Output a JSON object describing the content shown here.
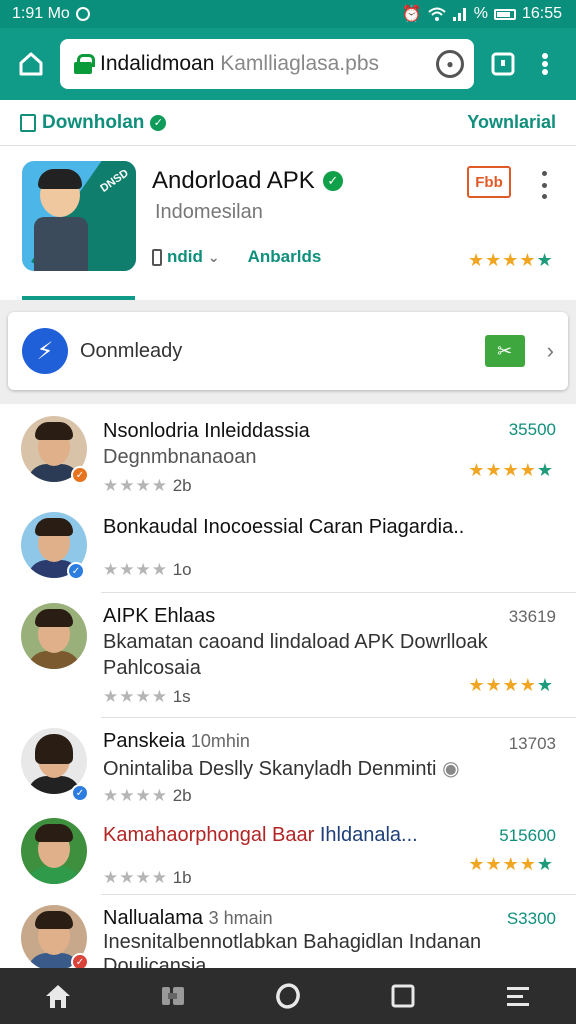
{
  "status_bar": {
    "time_left": "1:91 Mo",
    "time_right": "16:55",
    "percent": "%"
  },
  "browser": {
    "url_main": "Indalidmoan ",
    "url_dim": "Kamlliaglasa.pbs",
    "tab_count": "",
    "icons": [
      "home-icon",
      "lock-icon",
      "refresh-icon",
      "tabs-icon",
      "kebab-icon"
    ]
  },
  "header": {
    "left_label": "Downholan",
    "right_label": "Yownlarial"
  },
  "app": {
    "name": "Andorload APK",
    "subtitle": "Indomesilan",
    "icon_text": "DNSD",
    "developer_label": "ndid",
    "category_label": "Anbarlds",
    "badge_label": "Fbb",
    "rating": 4.5
  },
  "download_card": {
    "label": "Oonmleady",
    "icon": "lightning-icon",
    "action_icon": "tools-icon"
  },
  "list": [
    {
      "title": "Nsonlodria  Inleiddassia",
      "title_muted": "",
      "sub": "Degnmbnanaoan",
      "sub2": "",
      "rating_text": "2b",
      "price": "35500",
      "stars": 4.5,
      "badge_color": "#e8731e",
      "shirt_color": "#2c3b55"
    },
    {
      "title": "",
      "title_muted": "",
      "sub": "Bonkaudal Inocoessial Caran Piagardia..",
      "sub2": "",
      "rating_text": "1o",
      "price": "",
      "stars": 0,
      "badge_color": "#2d7de0",
      "shirt_color": "#2c3b6e"
    },
    {
      "title": "AIPK Ehlaas",
      "title_muted": "",
      "sub": "Bkamatan caoand lindaload APK Dowrlloak",
      "sub2": "Pahlcosaia",
      "rating_text": "1s",
      "price": "33619",
      "stars": 4.5,
      "badge_color": "",
      "shirt_color": "#7a5a2e"
    },
    {
      "title": "Panskeia",
      "title_muted": "10mhin",
      "sub": "Onintaliba Deslly Skanyladh Denminti",
      "sub2": "",
      "rating_text": "2b",
      "price": "13703",
      "stars": 0,
      "badge_color": "#2d7de0",
      "shirt_color": "#222222"
    },
    {
      "title": "Kamahaorphongal Baar",
      "title_muted": "Ihldanala...",
      "sub": "",
      "sub2": "",
      "rating_text": "1b",
      "price": "515600",
      "stars": 4.5,
      "badge_color": "",
      "shirt_color": "#2f9a4a"
    },
    {
      "title": "Nallualama",
      "title_muted": "3 hmain",
      "sub": "Inesnitalbennotlabkan Bahagidlan Indanan",
      "sub2": "Doulicansia",
      "rating_text": "",
      "price": "S3300",
      "stars": 0,
      "badge_color": "#d9433a",
      "shirt_color": "#3a5a8a"
    }
  ],
  "bottom_nav": [
    "home-icon",
    "apps-icon",
    "circle-icon",
    "square-icon",
    "menu-icon"
  ]
}
